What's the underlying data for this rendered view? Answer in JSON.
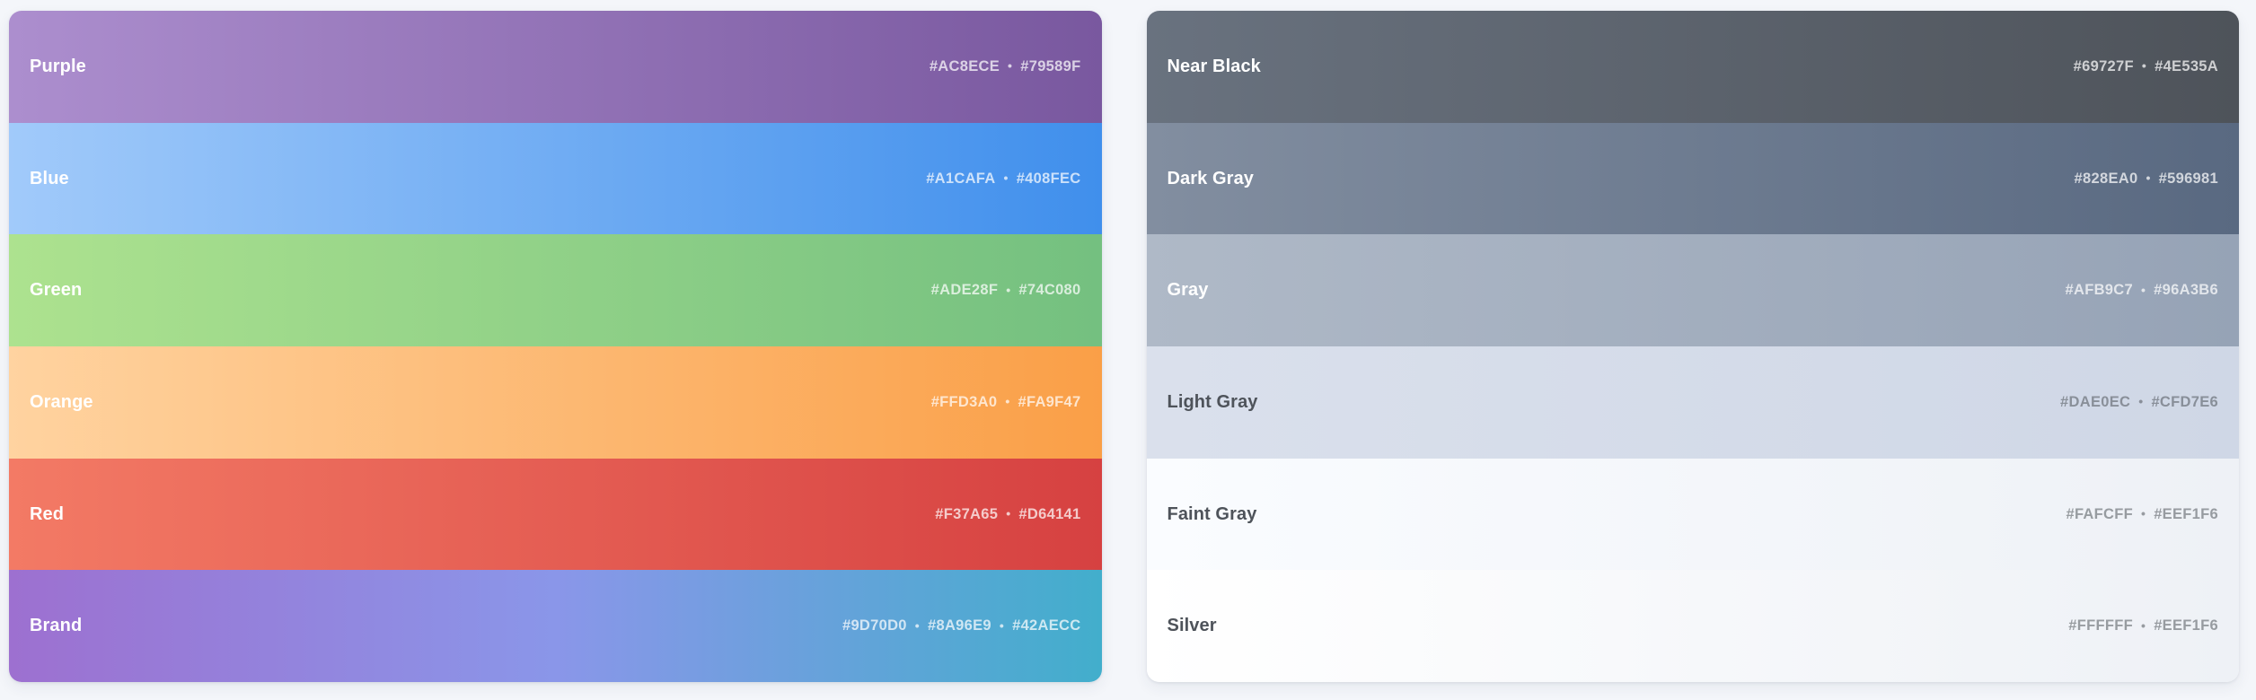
{
  "background_color": "#F4F6FA",
  "separator_glyph": "•",
  "cards": [
    {
      "name": "color-palette-card",
      "rows": [
        {
          "label": "Purple",
          "stops": [
            "#AC8ECE",
            "#79589F"
          ],
          "ink": "light"
        },
        {
          "label": "Blue",
          "stops": [
            "#A1CAFA",
            "#408FEC"
          ],
          "ink": "light"
        },
        {
          "label": "Green",
          "stops": [
            "#ADE28F",
            "#74C080"
          ],
          "ink": "light"
        },
        {
          "label": "Orange",
          "stops": [
            "#FFD3A0",
            "#FA9F47"
          ],
          "ink": "light"
        },
        {
          "label": "Red",
          "stops": [
            "#F37A65",
            "#D64141"
          ],
          "ink": "light"
        },
        {
          "label": "Brand",
          "stops": [
            "#9D70D0",
            "#8A96E9",
            "#42AECC"
          ],
          "ink": "light"
        }
      ]
    },
    {
      "name": "neutral-palette-card",
      "rows": [
        {
          "label": "Near Black",
          "stops": [
            "#69727F",
            "#4E535A"
          ],
          "ink": "light"
        },
        {
          "label": "Dark Gray",
          "stops": [
            "#828EA0",
            "#596981"
          ],
          "ink": "light"
        },
        {
          "label": "Gray",
          "stops": [
            "#AFB9C7",
            "#96A3B6"
          ],
          "ink": "light"
        },
        {
          "label": "Light Gray",
          "stops": [
            "#DAE0EC",
            "#CFD7E6"
          ],
          "ink": "dark"
        },
        {
          "label": "Faint Gray",
          "stops": [
            "#FAFCFF",
            "#EEF1F6"
          ],
          "ink": "dark"
        },
        {
          "label": "Silver",
          "stops": [
            "#FFFFFF",
            "#EEF1F6"
          ],
          "ink": "dark"
        }
      ]
    }
  ]
}
